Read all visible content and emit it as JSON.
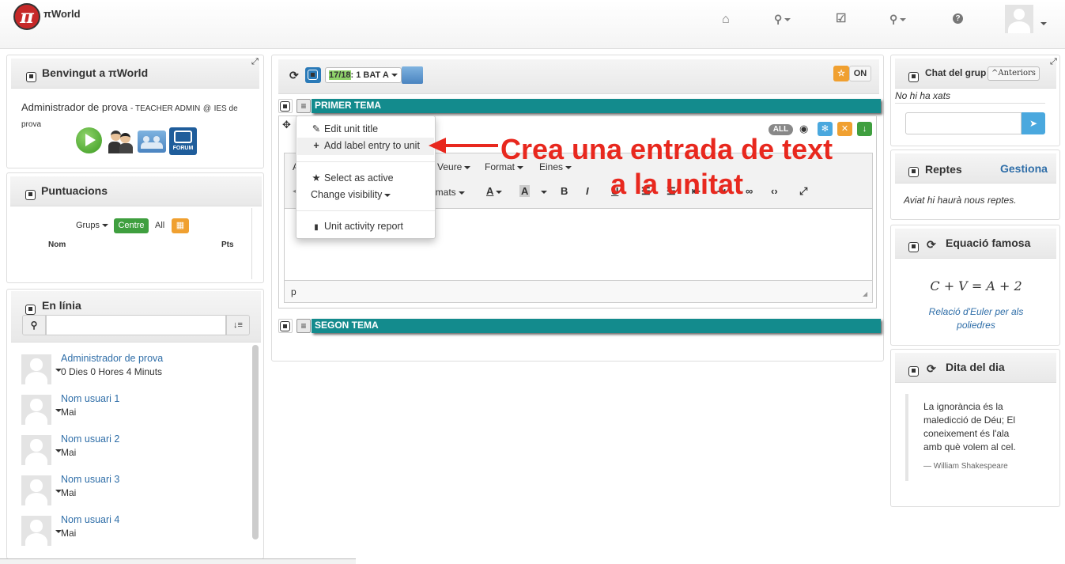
{
  "navbar": {
    "logo_glyph": "π",
    "brand": "πWorld",
    "icons": [
      "home-icon",
      "paperclip-icon",
      "edit-icon",
      "paperclip-icon",
      "help-icon"
    ]
  },
  "welcome": {
    "title": "Benvingut a πWorld",
    "user_name": "Administrador de prova",
    "role": "TEACHER ADMIN",
    "at": "@",
    "school": "IES de prova",
    "forum_label": "FORUM"
  },
  "scores": {
    "title": "Puntuacions",
    "groups_label": "Grups",
    "centre_label": "Centre",
    "all_label": "All",
    "col_name": "Nom",
    "col_pts": "Pts"
  },
  "online": {
    "title": "En línia",
    "search_placeholder": "",
    "users": [
      {
        "name": "Administrador de prova",
        "status": "0 Dies 0 Hores 4 Minuts"
      },
      {
        "name": "Nom usuari 1",
        "status": "Mai"
      },
      {
        "name": "Nom usuari 2",
        "status": "Mai"
      },
      {
        "name": "Nom usuari 3",
        "status": "Mai"
      },
      {
        "name": "Nom usuari 4",
        "status": "Mai"
      }
    ]
  },
  "center": {
    "course_year": "17/18",
    "course_group": ": 1 BAT A",
    "on_label": "ON",
    "units": [
      {
        "title": "PRIMER TEMA"
      },
      {
        "title": "SEGON TEMA"
      }
    ],
    "all_badge": "ALL",
    "editor": {
      "menu": [
        "Veure",
        "Format",
        "Eines"
      ],
      "formats_label": "ormats",
      "status_path": "p"
    },
    "dropdown": [
      {
        "icon": "pencil-icon",
        "glyph": "✎",
        "label": "Edit unit title"
      },
      {
        "icon": "plus-icon",
        "glyph": "+",
        "label": "Add label entry to unit"
      },
      {
        "icon": "star-icon",
        "glyph": "★",
        "label": "Select as active"
      },
      {
        "icon": "",
        "glyph": "",
        "label": "Change visibility"
      },
      {
        "icon": "file-icon",
        "glyph": "▮",
        "label": "Unit activity report"
      }
    ],
    "annotation": {
      "line1": "Crea una entrada de text",
      "line2": "a la unitat",
      "color": "#e8281e"
    }
  },
  "chat": {
    "title": "Chat del grup",
    "previous_label": "Anteriors",
    "empty_text": "No hi ha xats"
  },
  "challenges": {
    "title": "Reptes",
    "manage_label": "Gestiona",
    "text": "Aviat hi haurà nous reptes."
  },
  "equation": {
    "title": "Equació famosa",
    "formula": "C + V = A + 2",
    "caption": "Relació d'Euler per als poliedres"
  },
  "quote": {
    "title": "Dita del dia",
    "lines": [
      "La ignorància és la",
      "maledicció de Déu; El",
      "coneixement és l'ala",
      "amb què volem al cel."
    ],
    "author": "— William Shakespeare"
  },
  "colors": {
    "unit_bar": "#138b8d",
    "centre_green": "#3f9f3f",
    "orange": "#f0a030",
    "accent_blue": "#2f6ea8",
    "annotation_red": "#e8281e"
  }
}
